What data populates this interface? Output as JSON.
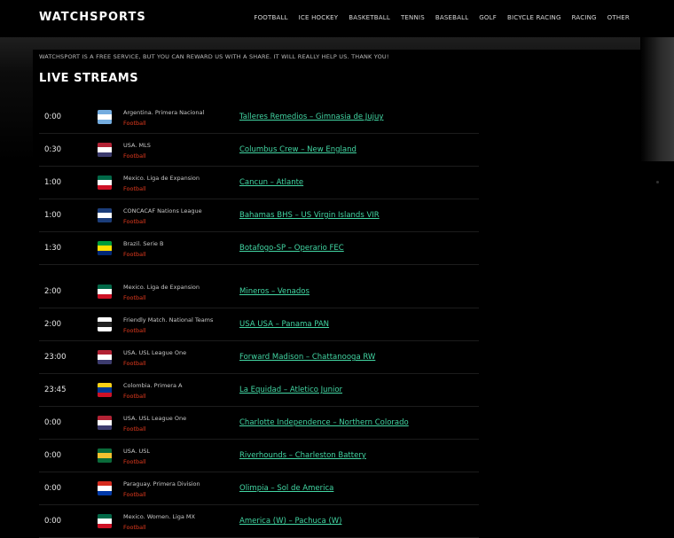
{
  "brand": {
    "logo": "WATCHSPORTS"
  },
  "nav": [
    "FOOTBALL",
    "ICE HOCKEY",
    "BASKETBALL",
    "TENNIS",
    "BASEBALL",
    "GOLF",
    "BICYCLE RACING",
    "RACING",
    "OTHER"
  ],
  "notice": "WATCHSPORT IS A FREE SERVICE, BUT YOU CAN REWARD US WITH A SHARE. IT WILL REALLY HELP US. THANK YOU!",
  "heading": "LIVE STREAMS",
  "streams": [
    {
      "time": "0:00",
      "league": "Argentina. Primera Nacional",
      "sport": "Football",
      "match": "Talleres Remedios – Gimnasia de Jujuy"
    },
    {
      "time": "0:30",
      "league": "USA. MLS",
      "sport": "Football",
      "match": "Columbus Crew – New England"
    },
    {
      "time": "1:00",
      "league": "Mexico. Liga de Expansion",
      "sport": "Football",
      "match": "Cancun – Atlante"
    },
    {
      "time": "1:00",
      "league": "CONCACAF Nations League",
      "sport": "Football",
      "match": "Bahamas BHS – US Virgin Islands VIR"
    },
    {
      "time": "1:30",
      "league": "Brazil. Serie B",
      "sport": "Football",
      "match": "Botafogo-SP – Operario FEC"
    },
    {
      "time": "2:00",
      "league": "Mexico. Liga de Expansion",
      "sport": "Football",
      "match": "Mineros – Venados"
    },
    {
      "time": "2:00",
      "league": "Friendly Match. National Teams",
      "sport": "Football",
      "match": "USA USA – Panama PAN"
    },
    {
      "time": "23:00",
      "league": "USA. USL League One",
      "sport": "Football",
      "match": "Forward Madison – Chattanooga RW"
    },
    {
      "time": "23:45",
      "league": "Colombia. Primera A",
      "sport": "Football",
      "match": "La Equidad – Atletico Junior"
    },
    {
      "time": "0:00",
      "league": "USA. USL League One",
      "sport": "Football",
      "match": "Charlotte Independence – Northern Colorado"
    },
    {
      "time": "0:00",
      "league": "USA. USL",
      "sport": "Football",
      "match": "Riverhounds – Charleston Battery"
    },
    {
      "time": "0:00",
      "league": "Paraguay. Primera Division",
      "sport": "Football",
      "match": "Olimpia – Sol de America"
    },
    {
      "time": "0:00",
      "league": "Mexico. Women. Liga MX",
      "sport": "Football",
      "match": "America (W) – Pachuca (W)"
    }
  ],
  "flag_colors": [
    [
      "#74acdf",
      "#ffffff",
      "#74acdf"
    ],
    [
      "#b22234",
      "#ffffff",
      "#3c3b6e"
    ],
    [
      "#006847",
      "#ffffff",
      "#ce1126"
    ],
    [
      "#1b3d7a",
      "#ffffff",
      "#1b3d7a"
    ],
    [
      "#009c3b",
      "#ffdf00",
      "#002776"
    ],
    [
      "#006847",
      "#ffffff",
      "#ce1126"
    ],
    [
      "#ffffff",
      "#222222",
      "#ffffff"
    ],
    [
      "#b22234",
      "#ffffff",
      "#3c3b6e"
    ],
    [
      "#fcd116",
      "#003893",
      "#ce1126"
    ],
    [
      "#b22234",
      "#ffffff",
      "#3c3b6e"
    ],
    [
      "#0a6b3a",
      "#f2c230",
      "#0a6b3a"
    ],
    [
      "#d52b1e",
      "#ffffff",
      "#0038a8"
    ],
    [
      "#006847",
      "#ffffff",
      "#ce1126"
    ]
  ]
}
